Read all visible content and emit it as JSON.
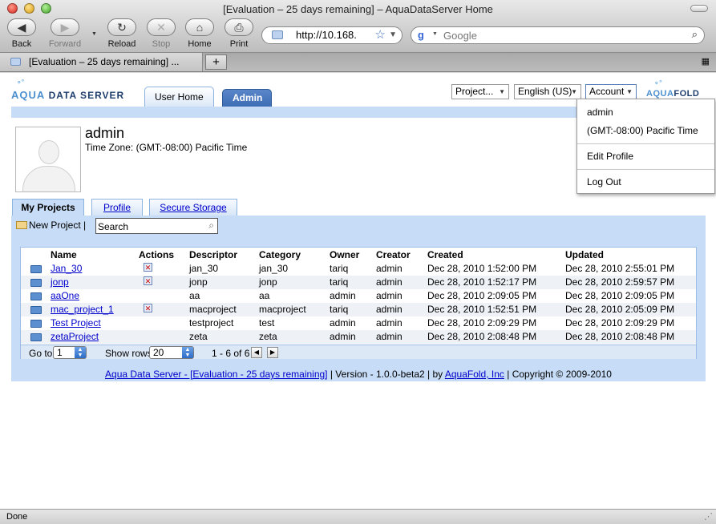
{
  "window": {
    "title": "[Evaluation – 25 days remaining] – AquaDataServer Home"
  },
  "toolbar": {
    "back": "Back",
    "forward": "Forward",
    "reload": "Reload",
    "stop": "Stop",
    "home": "Home",
    "print": "Print",
    "url": "http://10.168.",
    "search_placeholder": "Google"
  },
  "tabs": {
    "active_label": "[Evaluation – 25 days remaining] ..."
  },
  "app": {
    "logo_aqua": "AQUA",
    "logo_rest": "DATA SERVER",
    "nav": {
      "user_home": "User Home",
      "admin": "Admin"
    },
    "selectors": {
      "project": "Project...",
      "language": "English (US)",
      "account": "Account"
    },
    "brand_aqua": "AQUA",
    "brand_fold": "FOLD",
    "account_menu": {
      "user": "admin",
      "timezone": "(GMT:-08:00) Pacific Time",
      "edit_profile": "Edit Profile",
      "log_out": "Log Out"
    }
  },
  "profile": {
    "name": "admin",
    "timezone": "Time Zone: (GMT:-08:00) Pacific Time"
  },
  "subtabs": {
    "my_projects": "My Projects",
    "profile": "Profile",
    "secure_storage": "Secure Storage"
  },
  "projects": {
    "new_project": "New Project",
    "separator": "|",
    "search_value": "Search",
    "headers": [
      "Name",
      "Actions",
      "Descriptor",
      "Category",
      "Owner",
      "Creator",
      "Created",
      "Updated"
    ],
    "rows": [
      {
        "name": "Jan_30",
        "action": true,
        "descriptor": "jan_30",
        "category": "jan_30",
        "owner": "tariq",
        "creator": "admin",
        "created": "Dec 28, 2010 1:52:00 PM",
        "updated": "Dec 28, 2010 2:55:01 PM"
      },
      {
        "name": "jonp",
        "action": true,
        "descriptor": "jonp",
        "category": "jonp",
        "owner": "tariq",
        "creator": "admin",
        "created": "Dec 28, 2010 1:52:17 PM",
        "updated": "Dec 28, 2010 2:59:57 PM"
      },
      {
        "name": "aaOne",
        "action": false,
        "descriptor": "aa",
        "category": "aa",
        "owner": "admin",
        "creator": "admin",
        "created": "Dec 28, 2010 2:09:05 PM",
        "updated": "Dec 28, 2010 2:09:05 PM"
      },
      {
        "name": "mac_project_1",
        "action": true,
        "descriptor": "macproject",
        "category": "macproject",
        "owner": "tariq",
        "creator": "admin",
        "created": "Dec 28, 2010 1:52:51 PM",
        "updated": "Dec 28, 2010 2:05:09 PM"
      },
      {
        "name": "Test Project",
        "action": false,
        "descriptor": "testproject",
        "category": "test",
        "owner": "admin",
        "creator": "admin",
        "created": "Dec 28, 2010 2:09:29 PM",
        "updated": "Dec 28, 2010 2:09:29 PM"
      },
      {
        "name": "zetaProject",
        "action": false,
        "descriptor": "zeta",
        "category": "zeta",
        "owner": "admin",
        "creator": "admin",
        "created": "Dec 28, 2010 2:08:48 PM",
        "updated": "Dec 28, 2010 2:08:48 PM"
      }
    ],
    "pager": {
      "goto_label": "Go to",
      "goto_value": "1",
      "rows_label": "Show rows",
      "rows_value": "20",
      "range": "1 - 6 of 6"
    }
  },
  "footer": {
    "product_link": "Aqua Data Server - [Evaluation - 25 days remaining]",
    "version": "| Version - 1.0.0-beta2 | by",
    "company_link": "AquaFold, Inc",
    "copyright": "| Copyright © 2009-2010"
  },
  "status": {
    "text": "Done"
  },
  "colors": {
    "accent_blue": "#c7dcf6",
    "admin_tab": "#4a78bf",
    "link": "#0000cc"
  }
}
